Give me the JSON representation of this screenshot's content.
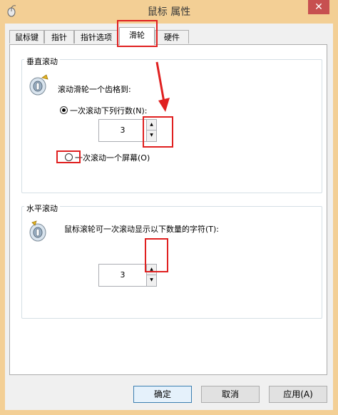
{
  "window": {
    "title": "鼠标 属性",
    "close_glyph": "✕"
  },
  "tabs": [
    {
      "label": "鼠标键"
    },
    {
      "label": "指针"
    },
    {
      "label": "指针选项"
    },
    {
      "label": "滑轮",
      "active": true
    },
    {
      "label": "硬件"
    }
  ],
  "vertical": {
    "group_label": "垂直滚动",
    "description": "滚动滑轮一个齿格到:",
    "option_lines": "一次滚动下列行数(N):",
    "option_lines_selected": true,
    "lines_value": "3",
    "option_screen": "一次滚动一个屏幕(O)",
    "option_screen_selected": false
  },
  "horizontal": {
    "group_label": "水平滚动",
    "description": "鼠标滚轮可一次滚动显示以下数量的字符(T):",
    "chars_value": "3"
  },
  "buttons": {
    "ok": "确定",
    "cancel": "取消",
    "apply": "应用(A)"
  },
  "colors": {
    "highlight_box": "#e02020",
    "title_bar": "#f3cf95"
  },
  "icons": {
    "arrow_up": "▲",
    "arrow_down": "▼"
  }
}
